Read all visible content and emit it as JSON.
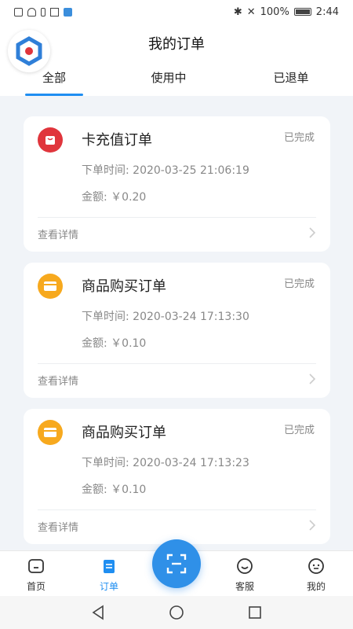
{
  "status_bar": {
    "battery": "100%",
    "time": "2:44"
  },
  "header": {
    "title": "我的订单"
  },
  "tabs": [
    {
      "label": "全部",
      "active": true
    },
    {
      "label": "使用中",
      "active": false
    },
    {
      "label": "已退单",
      "active": false
    }
  ],
  "orders": [
    {
      "icon": "bag-icon",
      "icon_color": "#e0353c",
      "title": "卡充值订单",
      "status": "已完成",
      "time": "下单时间: 2020-03-25 21:06:19",
      "amount": "金额: ￥0.20",
      "detail": "查看详情"
    },
    {
      "icon": "card-icon",
      "icon_color": "#f7a91e",
      "title": "商品购买订单",
      "status": "已完成",
      "time": "下单时间: 2020-03-24 17:13:30",
      "amount": "金额: ￥0.10",
      "detail": "查看详情"
    },
    {
      "icon": "card-icon",
      "icon_color": "#f7a91e",
      "title": "商品购买订单",
      "status": "已完成",
      "time": "下单时间: 2020-03-24 17:13:23",
      "amount": "金额: ￥0.10",
      "detail": "查看详情"
    }
  ],
  "bottom_nav": [
    {
      "label": "首页",
      "icon": "home-icon",
      "active": false
    },
    {
      "label": "订单",
      "icon": "order-icon",
      "active": true
    },
    {
      "label": "客服",
      "icon": "service-icon",
      "active": false
    },
    {
      "label": "我的",
      "icon": "profile-icon",
      "active": false
    }
  ],
  "scan_button": {
    "icon": "scan-icon"
  },
  "colors": {
    "accent": "#1f8ef1",
    "background": "#f1f4f8"
  }
}
